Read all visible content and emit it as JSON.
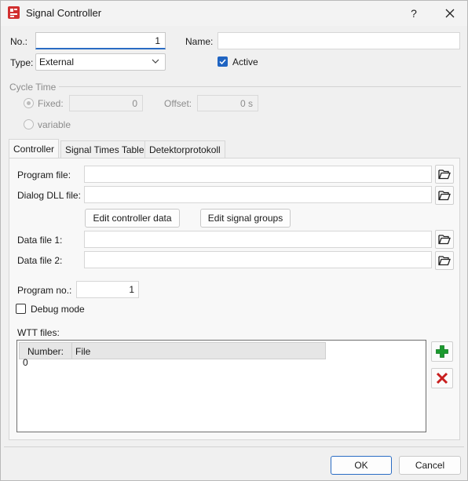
{
  "window": {
    "title": "Signal Controller",
    "help_glyph": "?",
    "close_glyph": "✕",
    "app_icon_text": "SC"
  },
  "header": {
    "no_label": "No.:",
    "no_value": "1",
    "name_label": "Name:",
    "name_value": "",
    "type_label": "Type:",
    "type_value": "External",
    "active_label": "Active",
    "active_checked": true
  },
  "cycle_time": {
    "group_label": "Cycle Time",
    "fixed_label": "Fixed:",
    "fixed_value": "0",
    "offset_label": "Offset:",
    "offset_value": "0 s",
    "variable_label": "variable"
  },
  "tabs": [
    {
      "label": "Controller",
      "active": true
    },
    {
      "label": "Signal Times Table",
      "active": false
    },
    {
      "label": "Detektorprotokoll",
      "active": false
    }
  ],
  "controller": {
    "program_file_label": "Program file:",
    "program_file_value": "",
    "dialog_dll_label": "Dialog DLL file:",
    "dialog_dll_value": "",
    "edit_controller_label": "Edit controller data",
    "edit_signal_groups_label": "Edit signal groups",
    "data_file1_label": "Data file 1:",
    "data_file1_value": "",
    "data_file2_label": "Data file 2:",
    "data_file2_value": "",
    "program_no_label": "Program no.:",
    "program_no_value": "1",
    "debug_mode_label": "Debug mode",
    "debug_mode_checked": false,
    "wtt_label": "WTT files:",
    "wtt_columns": [
      "Number: 0",
      "File"
    ],
    "wtt_rows": []
  },
  "icons": {
    "folder": "folder-open-icon",
    "add": "plus-icon",
    "remove": "delete-x-icon"
  },
  "colors": {
    "accent": "#2a6cc4",
    "checkbox_checked": "#1f64c2",
    "add_green": "#1a9a2e",
    "remove_red": "#c81e1e",
    "app_icon_red": "#d12f2f"
  },
  "footer": {
    "ok_label": "OK",
    "cancel_label": "Cancel"
  }
}
